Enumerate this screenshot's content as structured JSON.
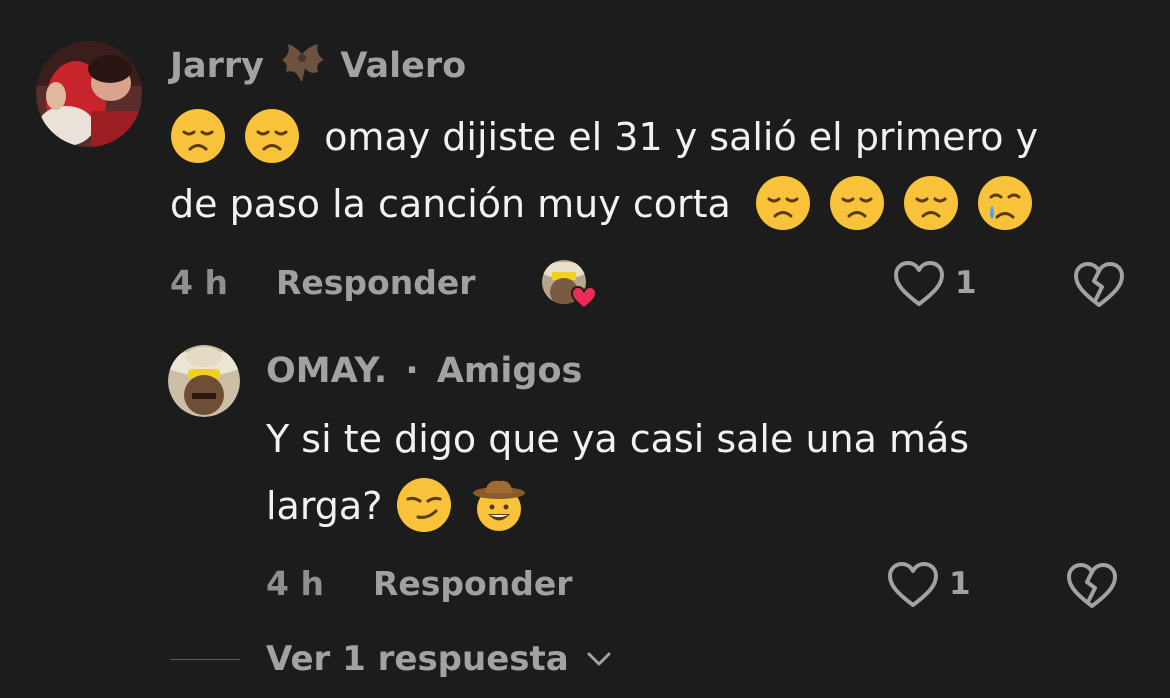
{
  "colors": {
    "background": "#1c1c1c",
    "username": "#a2a2a2",
    "body": "#f2f2f2",
    "meta": "#8f8f8f",
    "heart": "#ee2b54"
  },
  "comments": [
    {
      "user_first": "Jarry",
      "user_emoji": "bat-emoji",
      "user_last": "Valero",
      "text_line1": "omay dijiste el 31 y salió el primero y",
      "text_line2": "de paso la canción muy corta",
      "leading_emojis": [
        "disappointed-face",
        "disappointed-face"
      ],
      "trailing_emojis": [
        "disappointed-face",
        "disappointed-face",
        "disappointed-face",
        "crying-face"
      ],
      "time": "4 h",
      "reply_label": "Responder",
      "likes": "1",
      "creator_liked": true
    },
    {
      "user": "OMAY.",
      "separator": "·",
      "badge": "Amigos",
      "text_line1": "Y si te digo que ya casi sale una más",
      "text_line2": "larga?",
      "trailing_emojis": [
        "smirking-face",
        "cowboy-face"
      ],
      "time": "4 h",
      "reply_label": "Responder",
      "likes": "1"
    }
  ],
  "footer": {
    "view_replies": "Ver 1 respuesta"
  }
}
